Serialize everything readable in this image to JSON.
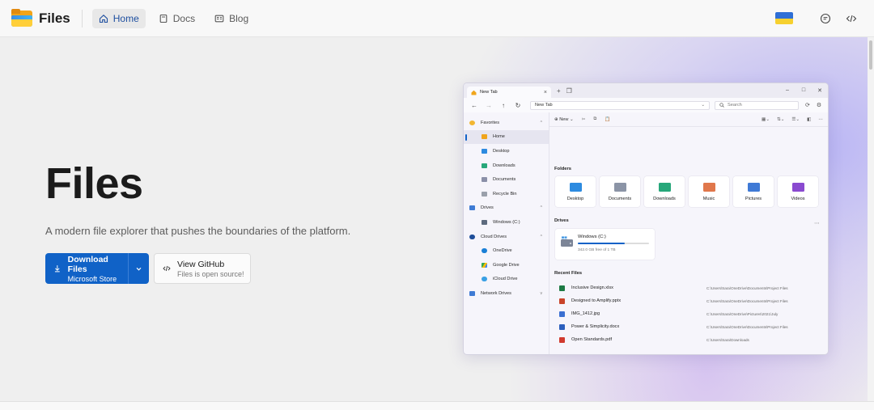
{
  "nav": {
    "brand": "Files",
    "items": [
      {
        "label": "Home",
        "icon": "home-icon",
        "active": true
      },
      {
        "label": "Docs",
        "icon": "docs-icon",
        "active": false
      },
      {
        "label": "Blog",
        "icon": "blog-icon",
        "active": false
      }
    ],
    "right_icons": [
      "ukraine-flag",
      "discord-icon",
      "code-icon"
    ]
  },
  "hero": {
    "title": "Files",
    "subtitle": "A modern file explorer that pushes the boundaries of the platform.",
    "download_label": "Download Files",
    "download_sub": "Microsoft Store",
    "github_label": "View GitHub",
    "github_sub": "Files is open source!"
  },
  "app": {
    "tab_title": "New Tab",
    "address": "New Tab",
    "search_placeholder": "Search",
    "new_label": "New",
    "sidebar": [
      {
        "label": "Favorites",
        "level": 0,
        "chevron": "^",
        "color": "#f2b632"
      },
      {
        "label": "Home",
        "level": 1,
        "active": true,
        "color": "#f0a51c"
      },
      {
        "label": "Desktop",
        "level": 1,
        "color": "#2d8be0"
      },
      {
        "label": "Downloads",
        "level": 1,
        "color": "#27a77a"
      },
      {
        "label": "Documents",
        "level": 1,
        "color": "#8a8fa8"
      },
      {
        "label": "Recycle Bin",
        "level": 1,
        "color": "#9aa0ab"
      },
      {
        "label": "Drives",
        "level": 0,
        "chevron": "^",
        "color": "#3f7bd4"
      },
      {
        "label": "Windows (C:)",
        "level": 1,
        "color": "#5d6a7e"
      },
      {
        "label": "Cloud Drives",
        "level": 0,
        "chevron": "^",
        "color": "#1f4e99"
      },
      {
        "label": "OneDrive",
        "level": 1,
        "color": "#1a7fd6"
      },
      {
        "label": "Google Drive",
        "level": 1,
        "color": "#34a853"
      },
      {
        "label": "iCloud Drive",
        "level": 1,
        "color": "#3aa0e4"
      },
      {
        "label": "Network Drives",
        "level": 0,
        "chevron": "v",
        "color": "#3f7bd4"
      }
    ],
    "folders_label": "Folders",
    "folders": [
      {
        "label": "Desktop",
        "color": "#2d8be0"
      },
      {
        "label": "Documents",
        "color": "#8b94a6"
      },
      {
        "label": "Downloads",
        "color": "#27a77a"
      },
      {
        "label": "Music",
        "color": "#e0774b"
      },
      {
        "label": "Pictures",
        "color": "#3f7ad6"
      },
      {
        "label": "Videos",
        "color": "#8a4ad0"
      }
    ],
    "drives_label": "Drives",
    "drive": {
      "name": "Windows (C:)",
      "size": "342.0 GB free of 1 TB",
      "used_fraction": 0.66
    },
    "recent_label": "Recent Files",
    "recent": [
      {
        "name": "Inclusive Design.xlsx",
        "path": "C:\\Users\\Sara\\OneDrive\\Documents\\Project Files",
        "color": "#1d7a44"
      },
      {
        "name": "Designed to Amplify.pptx",
        "path": "C:\\Users\\Sara\\OneDrive\\Documents\\Project Files",
        "color": "#c9442a"
      },
      {
        "name": "IMG_1412.jpg",
        "path": "C:\\Users\\Sara\\OneDrive\\Pictures\\2021\\July",
        "color": "#3a6fd1"
      },
      {
        "name": "Power & Simplicity.docx",
        "path": "C:\\Users\\Sara\\OneDrive\\Documents\\Project Files",
        "color": "#2b5fbd"
      },
      {
        "name": "Open Standards.pdf",
        "path": "C:\\Users\\Sara\\Downloads",
        "color": "#d13a2e"
      }
    ]
  },
  "colors": {
    "accent": "#1062c7",
    "page_bg": "#efefef",
    "glow": "#b6aef2"
  }
}
